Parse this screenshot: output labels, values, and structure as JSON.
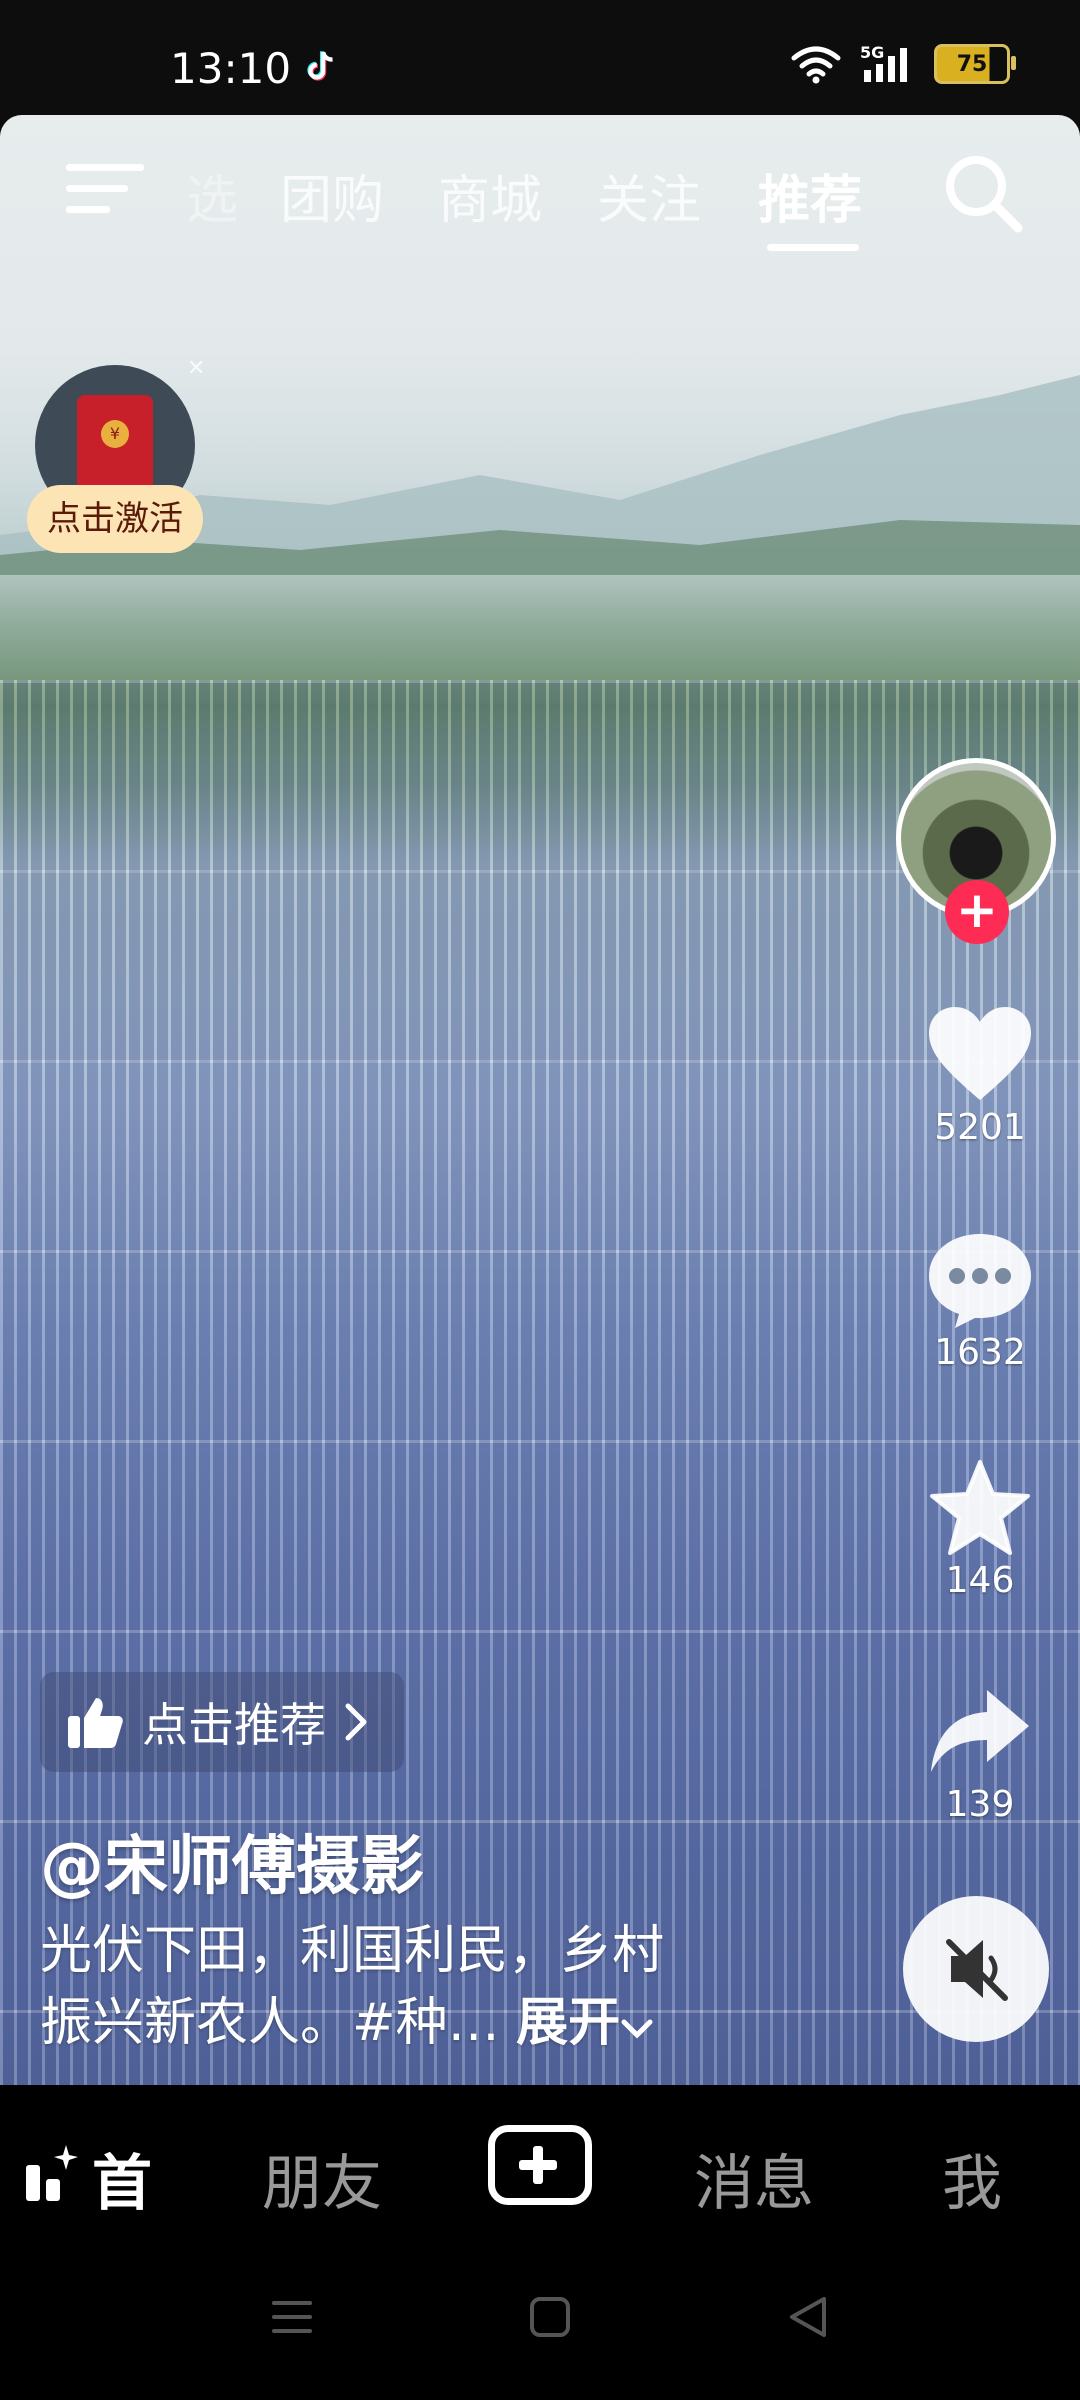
{
  "status_bar": {
    "time": "13:10",
    "network": "5G",
    "battery": "75"
  },
  "top_tabs": [
    {
      "label": "选",
      "active": false
    },
    {
      "label": "团购",
      "active": false
    },
    {
      "label": "商城",
      "active": false
    },
    {
      "label": "关注",
      "active": false
    },
    {
      "label": "推荐",
      "active": true
    }
  ],
  "red_packet": {
    "label": "点击激活"
  },
  "actions": {
    "likes": "5201",
    "comments": "1632",
    "favorites": "146",
    "shares": "139"
  },
  "recommend": {
    "label": "点击推荐"
  },
  "post": {
    "author": "@宋师傅摄影",
    "caption_line1": "光伏下田，利国利民，乡村",
    "caption_line2": "振兴新农人。#种…",
    "expand": "展开"
  },
  "bottom_tabs": {
    "home": "首",
    "friends": "朋友",
    "messages": "消息",
    "me": "我"
  },
  "colors": {
    "accent": "#fe2c55",
    "tabbar": "#000000"
  }
}
